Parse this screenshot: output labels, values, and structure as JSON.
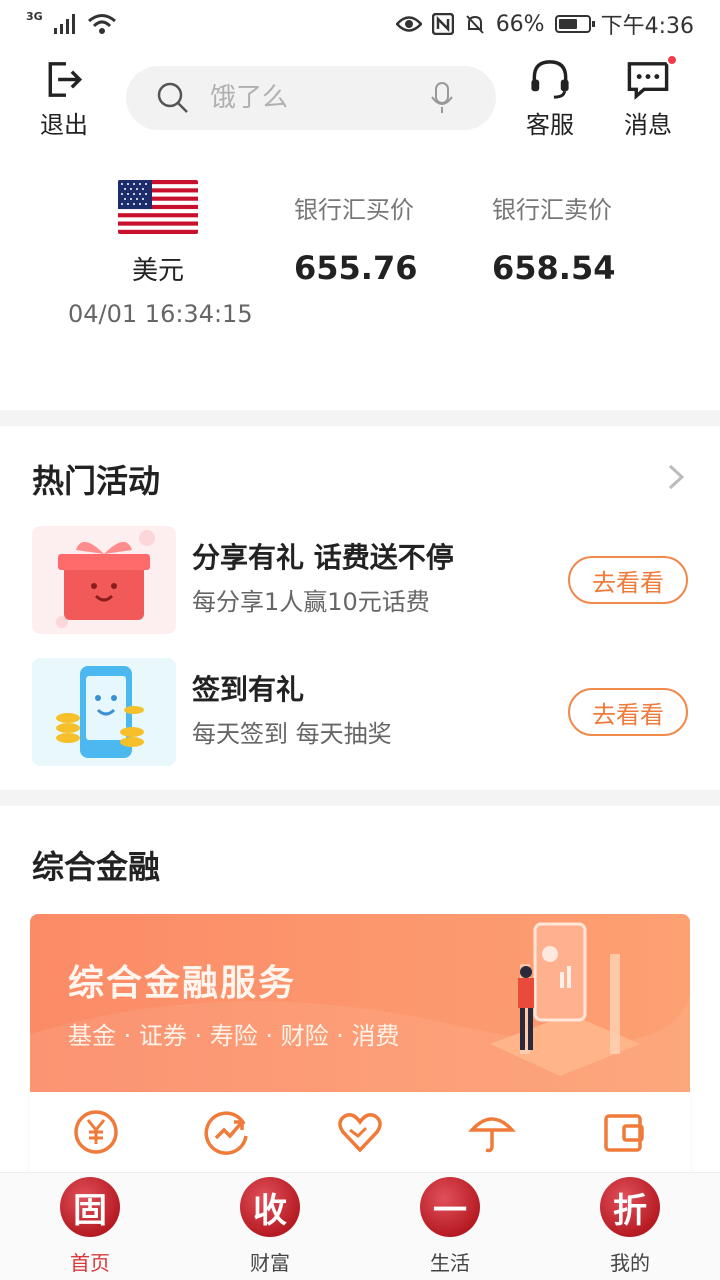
{
  "status_bar": {
    "network": "3G",
    "battery_percent": "66%",
    "battery_level": 0.66,
    "time": "下午4:36"
  },
  "header": {
    "logout_label": "退出",
    "search_placeholder": "饿了么",
    "service_label": "客服",
    "message_label": "消息"
  },
  "rates": {
    "currency": "美元",
    "timestamp": "04/01 16:34:15",
    "buy_label": "银行汇买价",
    "buy_value": "655.76",
    "sell_label": "银行汇卖价",
    "sell_value": "658.54"
  },
  "hot": {
    "title": "热门活动",
    "items": [
      {
        "title": "分享有礼 话费送不停",
        "subtitle": "每分享1人赢10元话费",
        "button": "去看看"
      },
      {
        "title": "签到有礼",
        "subtitle": "每天签到 每天抽奖",
        "button": "去看看"
      }
    ]
  },
  "finance": {
    "title": "综合金融",
    "banner_title": "综合金融服务",
    "banner_subtitle": "基金 · 证券 · 寿险 · 财险 · 消费",
    "icons": [
      "yen-icon",
      "trend-icon",
      "heart-icon",
      "umbrella-icon",
      "wallet-icon"
    ],
    "accent": "#f07a3a"
  },
  "nav": {
    "items": [
      {
        "glyph": "固",
        "label": "首页",
        "active": true
      },
      {
        "glyph": "收",
        "label": "财富",
        "active": false
      },
      {
        "glyph": "一",
        "label": "生活",
        "active": false
      },
      {
        "glyph": "折",
        "label": "我的",
        "active": false
      }
    ],
    "active_color": "#d83a3a"
  }
}
